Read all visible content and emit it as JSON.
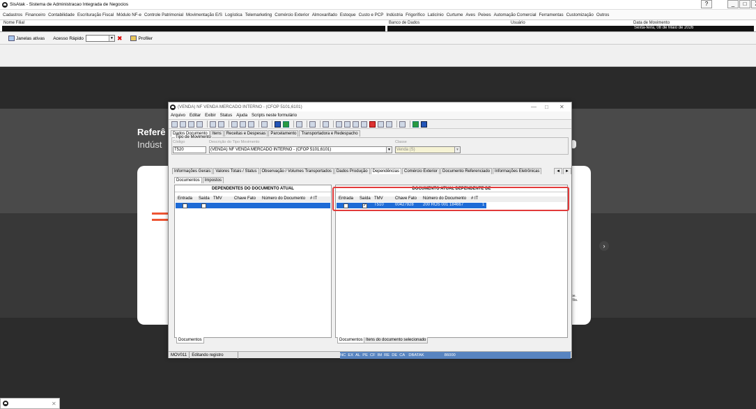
{
  "app": {
    "title": "SisAtak - Sistema de Administracao Integrada de Negocios"
  },
  "window_controls": {
    "help": "?",
    "minimize": "_",
    "maximize": "□",
    "close": "X"
  },
  "menu": [
    "Cadastros",
    "Financeiro",
    "Contabilidade",
    "Escrituração Fiscal",
    "Módulo NF-e",
    "Controle Patrimonial",
    "Movimentação E/S",
    "Logística",
    "Telemarketing",
    "Comércio Exterior",
    "Almoxarifado",
    "Estoque",
    "Custo e PCP",
    "Indústria",
    "Frigorífico",
    "Laticínio",
    "Curtume",
    "Aves",
    "Peixes",
    "Automação Comercial",
    "Ferramentas",
    "Customização",
    "Outros"
  ],
  "info_header": {
    "filial_label": "Nome Filial",
    "banco_label": "Banco de Dados",
    "usuario_label": "Usuário",
    "data_label": "Data de Movimento",
    "data_value": "Sexta-feira, 08 de Maio de 2026"
  },
  "toolbar": {
    "janelas": "Janelas ativas",
    "acesso_rapido": "Acesso Rápido",
    "profiler": "Profiler"
  },
  "promo": {
    "title": "Referê",
    "subtitle": "Indúst",
    "text1": "pe.",
    "text2": "fília."
  },
  "dialog": {
    "title": "(VENDA) NF VENDA MERCADO INTERNO - (CFOP 5101,6101)",
    "menu": [
      "Arquivo",
      "Editar",
      "Exibir",
      "Status",
      "Ajuda",
      "Scripts neste formulário"
    ],
    "tabs": [
      "Dados Documento",
      "Itens",
      "Receitas e Despesas",
      "Parcelamento",
      "Transportadora e Redespacho"
    ],
    "group_label": "Tipo de Movimento",
    "codigo_label": "Código",
    "codigo_value": "T520",
    "descricao_label": "Descrição do Tipo Movimento",
    "descricao_value": "(VENDA) NF VENDA MERCADO INTERNO - (CFOP 5101,6101)",
    "classe_label": "Classe",
    "classe_value": "Venda (S)",
    "subtabs": [
      "Informações Gerais",
      "Valores Totais / Status",
      "Observação / Volumes Transportados",
      "Dados Produção",
      "Dependências",
      "Comércio Exterior",
      "Documento Referenciado",
      "Informações Eletrônicas"
    ],
    "subtabs2": [
      "Documentos",
      "Impostos"
    ],
    "left_panel": {
      "title": "DEPENDENTES DO DOCUMENTO ATUAL",
      "columns": [
        "Entrada",
        "Saída",
        "TMV",
        "Chave Fato",
        "Número do Documento",
        "# IT"
      ],
      "bottom_tab": "Documentos"
    },
    "right_panel": {
      "title": "DOCUMENTO ATUAL DEPENDENTE DE",
      "columns": [
        "Entrada",
        "Saída",
        "TMV",
        "Chave Fato",
        "Número do Documento",
        "# IT"
      ],
      "row": {
        "tmv": "T510",
        "chave": "00427928",
        "numero": "200 ROS 001 184667",
        "it": "1"
      },
      "bottom_tabs": [
        "Documentos",
        "Itens do documento selecionado"
      ]
    },
    "statusbar": {
      "code": "MOV011",
      "mode": "Editando registro",
      "flags": [
        "NC",
        "EX",
        "AL",
        "PE",
        "CF",
        "IM",
        "RE",
        "DE",
        "CA"
      ],
      "db": "DBATAK",
      "num": "86000"
    }
  }
}
